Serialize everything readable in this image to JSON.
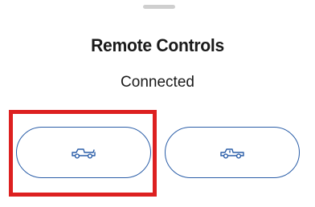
{
  "sheet": {
    "title": "Remote Controls",
    "status": "Connected"
  },
  "controls": [
    {
      "icon": "truck-bed-open-icon"
    },
    {
      "icon": "truck-bed-closed-icon"
    }
  ],
  "highlight": {
    "color": "#dd2020"
  },
  "colors": {
    "accent": "#2b5ea8",
    "text": "#1a1a1a",
    "handle": "#cfcfcf"
  }
}
